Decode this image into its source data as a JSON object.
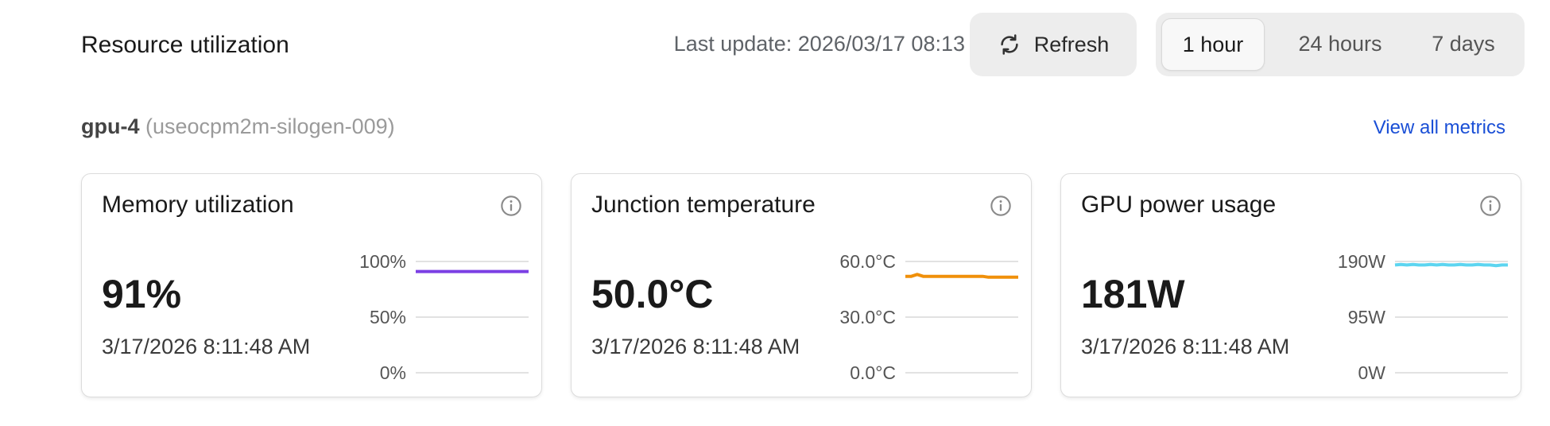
{
  "header": {
    "title": "Resource utilization",
    "last_update": "Last update: 2026/03/17 08:13",
    "refresh_label": "Refresh",
    "time_ranges": [
      {
        "label": "1 hour",
        "active": true
      },
      {
        "label": "24 hours",
        "active": false
      },
      {
        "label": "7 days",
        "active": false
      }
    ]
  },
  "node": {
    "name": "gpu-4",
    "host": "(useocpm2m-silogen-009)",
    "view_all_label": "View all metrics"
  },
  "cards": [
    {
      "title": "Memory utilization",
      "value": "91%",
      "timestamp": "3/17/2026 8:11:48 AM",
      "color": "#7b3fe4",
      "ticks": [
        "100%",
        "50%",
        "0%"
      ],
      "ymax": 100,
      "series": [
        91,
        91,
        91,
        91,
        91,
        91,
        91,
        91,
        91,
        91
      ]
    },
    {
      "title": "Junction temperature",
      "value": "50.0°C",
      "timestamp": "3/17/2026 8:11:48 AM",
      "color": "#f0900a",
      "ticks": [
        "60.0°C",
        "30.0°C",
        "0.0°C"
      ],
      "ymax": 60,
      "series": [
        52,
        52,
        53,
        52,
        52,
        52,
        52,
        52,
        52,
        52,
        52,
        52,
        52,
        52,
        51.5,
        51.5,
        51.5,
        51.5,
        51.5,
        51.5
      ]
    },
    {
      "title": "GPU power usage",
      "value": "181W",
      "timestamp": "3/17/2026 8:11:48 AM",
      "color": "#5dd5f0",
      "ticks": [
        "190W",
        "95W",
        "0W"
      ],
      "ymax": 190,
      "series": [
        184,
        185,
        184,
        185,
        184,
        184,
        185,
        184,
        185,
        184,
        184,
        185,
        184,
        184,
        185,
        184,
        184,
        183,
        184,
        184
      ]
    }
  ]
}
